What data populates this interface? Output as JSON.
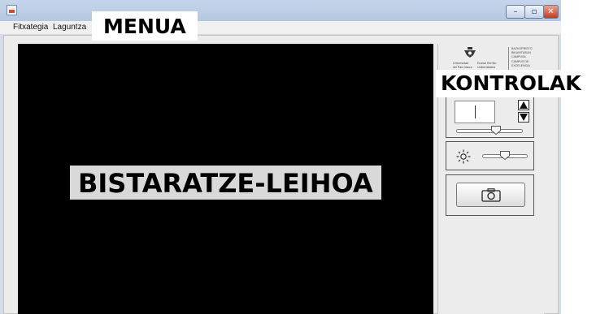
{
  "menubar": {
    "items": [
      "Fitxategia",
      "Laguntza"
    ]
  },
  "title_controls": {
    "minimize": "–",
    "maximize": "▫",
    "close": "✕"
  },
  "annotations": {
    "menu": "MENUA",
    "controls": "KONTROLAK",
    "display": "BISTARATZE-LEIHOA"
  },
  "logo": {
    "university_line1": "Universidad",
    "university_line2": "del País Vasco",
    "basque_line1": "Euskal Herriko",
    "basque_line2": "Unibertsitatea",
    "campus": [
      "BAZKOPRISTO",
      "BIKAINTASUN",
      "CAMPUSA",
      "CAMPUS DE",
      "EXCELENCIA"
    ]
  },
  "controls": {
    "value_field": "",
    "zoom_level": 0.6,
    "brightness_level": 0.5
  },
  "icons": {
    "up": "arrow-up-icon",
    "down": "arrow-down-icon",
    "brightness": "brightness-icon",
    "camera": "camera-icon"
  },
  "colors": {
    "display_background": "#000000",
    "window_chrome": "#c6d5ea",
    "close_button": "#c53a1e"
  }
}
